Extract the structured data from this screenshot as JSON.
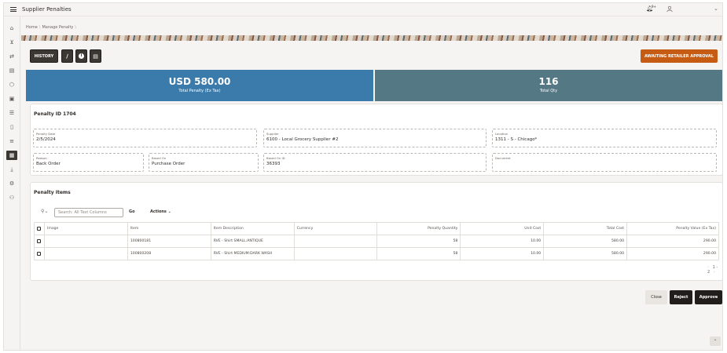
{
  "header": {
    "title": "Supplier Penalties",
    "notification_count": "9+"
  },
  "breadcrumb": {
    "home": "Home",
    "current": "Manage Penalty"
  },
  "toolbar": {
    "history_label": "HISTORY",
    "status_label": "AWAITING RETAILER APPROVAL"
  },
  "summary": {
    "total_penalty_value": "USD 580.00",
    "total_penalty_label": "Total Penalty (Ex Tax)",
    "total_qty_value": "116",
    "total_qty_label": "Total Qty",
    "colors": {
      "penalty_tile": "#3b7bab",
      "qty_tile": "#557885",
      "accent": "#c65b14"
    }
  },
  "penalty": {
    "title": "Penalty ID 1704",
    "fields": {
      "penalty_date": {
        "label": "Penalty Date",
        "value": "2/5/2024"
      },
      "supplier": {
        "label": "Supplier",
        "value": "6100 - Local Grocery Supplier #2"
      },
      "location": {
        "label": "Location",
        "value": "1311 - S - Chicago*"
      },
      "reason": {
        "label": "Reason",
        "value": "Back Order"
      },
      "based_on": {
        "label": "Based On",
        "value": "Purchase Order"
      },
      "based_on_id": {
        "label": "Based On ID",
        "value": "36393"
      },
      "document": {
        "label": "Document",
        "value": ""
      }
    }
  },
  "items": {
    "title": "Penalty Items",
    "search_placeholder": "Search: All Text Columns",
    "go_label": "Go",
    "actions_label": "Actions",
    "columns": [
      "Image",
      "Item",
      "Item Description",
      "Currency",
      "Penalty Quantity",
      "Unit Cost",
      "Total Cost",
      "Penalty Value (Ex Tax)"
    ],
    "rows": [
      [
        "",
        "100800181",
        "RVE - Shirt SMALL:ANTIQUE",
        "",
        "58",
        "10.00",
        "580.00",
        "290.00"
      ],
      [
        "",
        "100800208",
        "RVE - Shirt MEDIUM:DARK WASH",
        "",
        "58",
        "10.00",
        "580.00",
        "290.00"
      ]
    ],
    "pagination": "1 - 2"
  },
  "footer": {
    "close_label": "Close",
    "reject_label": "Reject",
    "approve_label": "Approve"
  },
  "icons": [
    "menu-icon",
    "bell-icon",
    "user-icon",
    "chevron-down-icon",
    "home-icon",
    "cart-icon",
    "return-icon",
    "calendar-icon",
    "box-icon",
    "report-icon",
    "list-icon",
    "clipboard-icon",
    "money-icon",
    "penalty-icon",
    "download-icon",
    "settings-icon",
    "person-icon",
    "attachment-icon",
    "info-icon",
    "document-icon",
    "search-icon",
    "chevron-up-icon"
  ]
}
